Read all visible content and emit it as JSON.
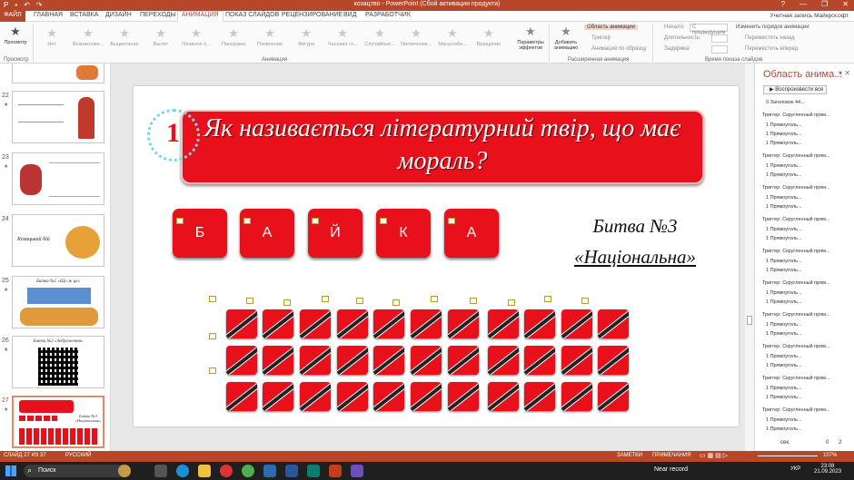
{
  "titlebar": {
    "title": "козацтво - PowerPoint (Сбой активации продукта)",
    "controls": [
      "?",
      "—",
      "❐",
      "✕"
    ]
  },
  "tabs": {
    "file": "ФАЙЛ",
    "items": [
      "ГЛАВНАЯ",
      "ВСТАВКА",
      "ДИЗАЙН",
      "ПЕРЕХОДЫ",
      "АНИМАЦИЯ",
      "ПОКАЗ СЛАЙДОВ",
      "РЕЦЕНЗИРОВАНИЕ",
      "ВИД",
      "РАЗРАБОТЧИК"
    ],
    "active": "АНИМАЦИЯ",
    "account": "Учетная запись Майкрософт"
  },
  "ribbon": {
    "preview": "Просмотр",
    "effects": [
      "Нет",
      "Возникнове...",
      "Выцветание",
      "Вылет",
      "Плавное п...",
      "Панорама",
      "Появление",
      "Фигура",
      "Часовая ст...",
      "Случайные...",
      "Увеличение...",
      "Масштаби...",
      "Вращение"
    ],
    "effect_params": "Параметры эффектов",
    "add_animation": "Добавить анимацию",
    "anim_pane": "Область анимации",
    "trigger": "Триггер",
    "anim_painter": "Анимация по образцу",
    "start_label": "Начало:",
    "start_value": "С предыдущим",
    "duration_label": "Длительность:",
    "delay_label": "Задержка:",
    "reorder_label": "Изменить порядок анимации",
    "move_earlier": "Переместить назад",
    "move_later": "Переместить вперед",
    "groups": [
      "Просмотр",
      "Анимация",
      "Расширенная анимация",
      "Время показа слайдов"
    ]
  },
  "slides": [
    {
      "n": "22"
    },
    {
      "n": "23"
    },
    {
      "n": "24",
      "caption": "Козацький бій"
    },
    {
      "n": "25",
      "caption": "Битва №1 «Що ж це»"
    },
    {
      "n": "26",
      "caption": "Битва №2 «Зображення»"
    },
    {
      "n": "27",
      "caption": "Битва №3 «Національна»"
    }
  ],
  "slide": {
    "number": "1",
    "question": "Як називається літературний твір, що має мораль?",
    "letters": [
      "Б",
      "А",
      "Й",
      "К",
      "А"
    ],
    "battle_line1": "Битва №3",
    "battle_line2": "«Національна»"
  },
  "anim_pane": {
    "title": "Область анима...",
    "play_all": "Воспроизвести все",
    "first_item": "0  Заголовок 44...",
    "trigger_label": "Триггер: Скругленный прям...",
    "item_label": "1  Прямоуголь...",
    "footer_unit": "сек.",
    "footer_nums": [
      "0",
      "2"
    ]
  },
  "statusbar": {
    "slide": "СЛАЙД 27 ИЗ 37",
    "lang": "РУССКИЙ",
    "notes": "ЗАМЕТКИ",
    "comments": "ПРИМЕЧАНИЯ",
    "zoom": "107%"
  },
  "taskbar": {
    "search": "Поиск",
    "near_record": "Near record",
    "time": "23:08",
    "date": "21.09.2023",
    "lang": "УКР"
  },
  "colors": {
    "accent": "#b7472a",
    "tile": "#e8101a"
  }
}
